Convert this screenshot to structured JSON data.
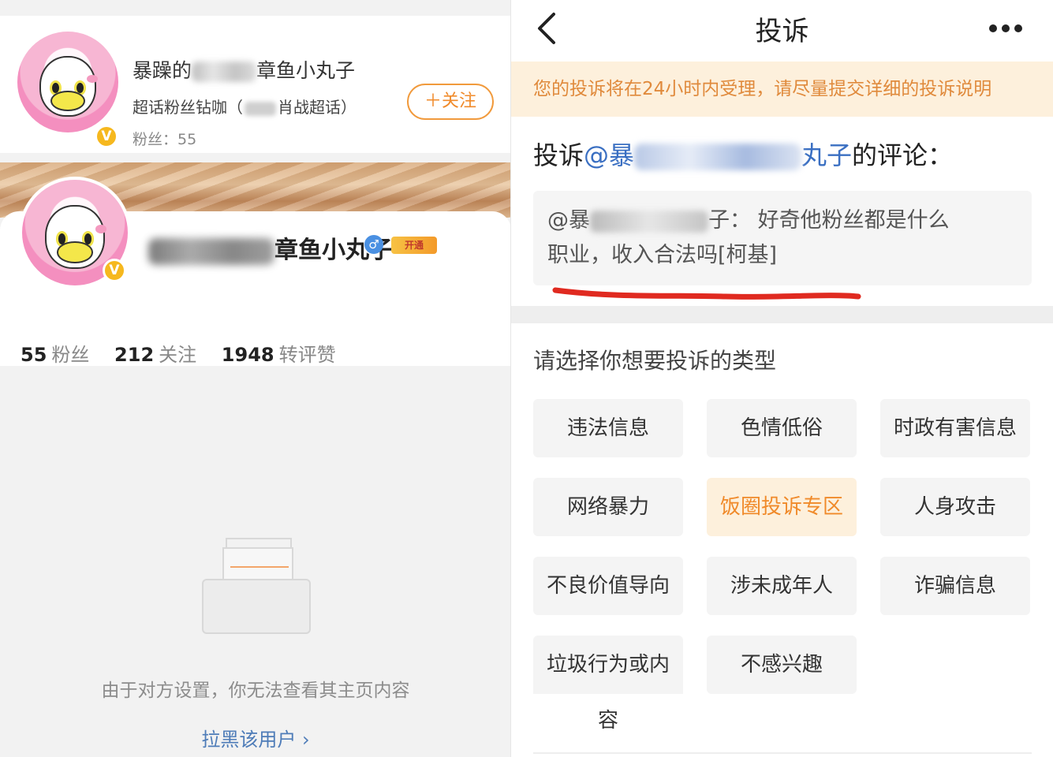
{
  "left": {
    "card": {
      "name_prefix": "暴躁的",
      "name_suffix": "章鱼小丸子",
      "subtitle_prefix": "超话粉丝钻咖（",
      "subtitle_suffix": "肖战超话）",
      "fans": "粉丝：55",
      "follow_label": "＋关注"
    },
    "profile": {
      "name_prefix": "暴躁的",
      "name_suffix": "章鱼小丸子",
      "gender_symbol": "♂",
      "vip_label": "开通",
      "stats": [
        {
          "num": "55",
          "label": "粉丝"
        },
        {
          "num": "212",
          "label": "关注"
        },
        {
          "num": "1948",
          "label": "转评赞"
        }
      ]
    },
    "empty_message": "由于对方设置，你无法查看其主页内容",
    "block_link": "拉黑该用户 ›"
  },
  "right": {
    "title": "投诉",
    "notice": "您的投诉将在24小时内受理，请尽量提交详细的投诉说明",
    "target_prefix": "投诉",
    "target_mention_start": "@暴",
    "target_mention_end": "丸子",
    "target_suffix": "的评论：",
    "comment_prefix": "@暴",
    "comment_line1_suffix": "子：  好奇他粉丝都是什么",
    "comment_line2": "职业，收入合法吗[柯基]",
    "choose_title": "请选择你想要投诉的类型",
    "categories": [
      "违法信息",
      "色情低俗",
      "时政有害信息",
      "网络暴力",
      "饭圈投诉专区",
      "人身攻击",
      "不良价值导向",
      "涉未成年人",
      "诈骗信息",
      "垃圾行为或内",
      "不感兴趣"
    ],
    "category_overflow": "容",
    "active_category": "饭圈投诉专区",
    "accent_color": "#f08a2a",
    "underline_color": "#e02a20"
  }
}
